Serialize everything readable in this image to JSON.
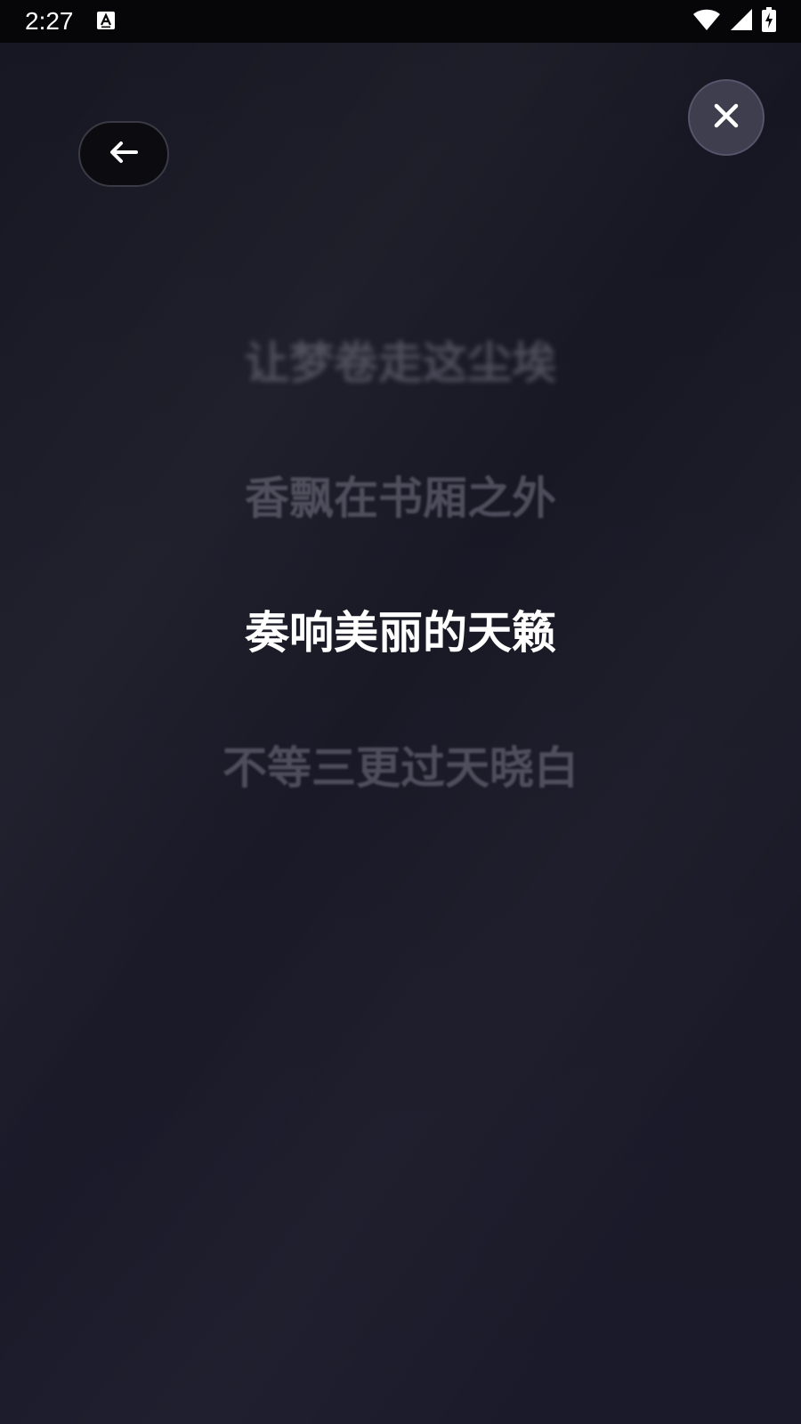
{
  "status_bar": {
    "time": "2:27",
    "notification_icon": "a-icon",
    "wifi_icon": "wifi-icon",
    "signal_icon": "cell-signal-icon",
    "battery_icon": "battery-charging-icon"
  },
  "controls": {
    "back_icon": "arrow-left-icon",
    "close_icon": "close-icon"
  },
  "lyrics": {
    "lines": [
      "",
      "让梦卷走这尘埃",
      "香飘在书厢之外",
      "奏响美丽的天籁",
      "不等三更过天晓白",
      "",
      "",
      ""
    ],
    "active_index": 3
  },
  "colors": {
    "background": "#191926",
    "active_lyric": "#ffffff",
    "inactive_lyric": "#78788a",
    "close_button_bg": "#3e3e4e",
    "back_button_bg": "#0c0c10"
  }
}
